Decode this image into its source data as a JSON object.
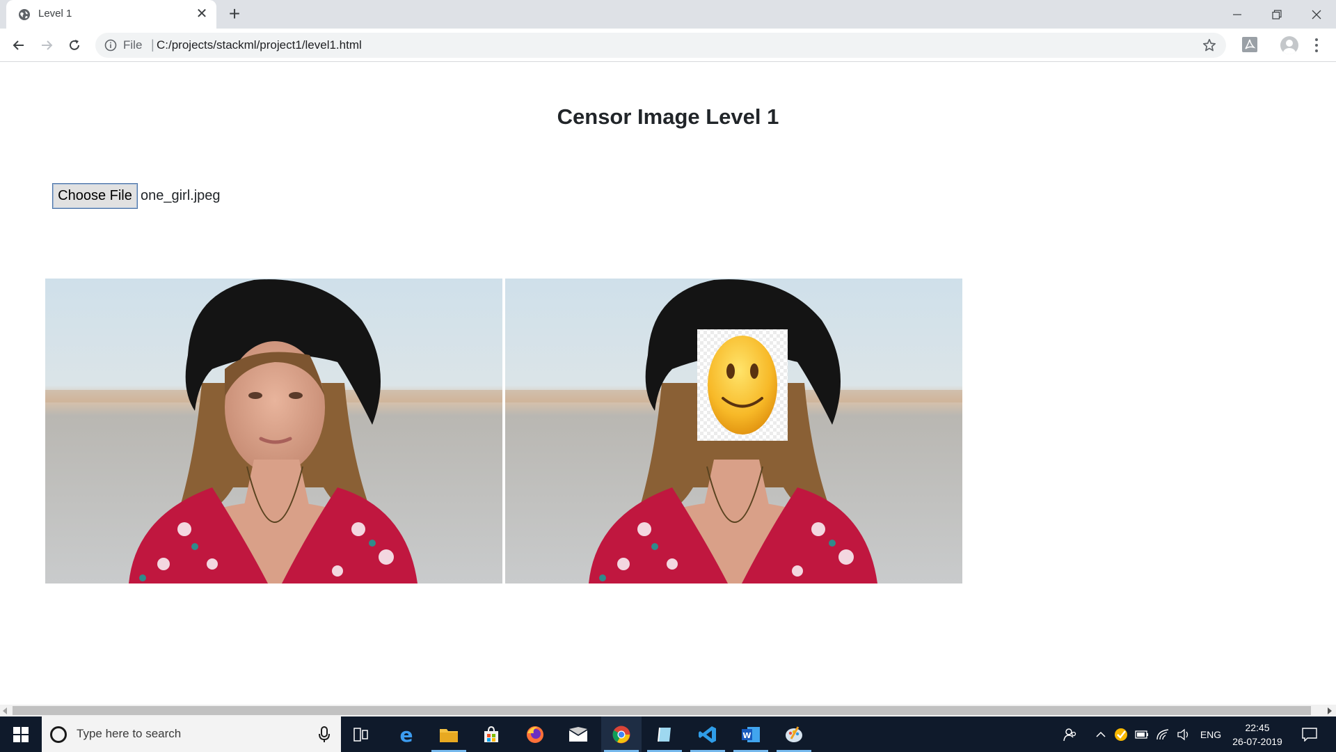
{
  "tab": {
    "title": "Level 1"
  },
  "omnibox": {
    "scheme": "File",
    "url": "C:/projects/stackml/project1/level1.html"
  },
  "page": {
    "title": "Censor Image Level 1",
    "choose_file_label": "Choose File",
    "file_name": "one_girl.jpeg"
  },
  "taskbar": {
    "search_placeholder": "Type here to search",
    "language": "ENG",
    "time": "22:45",
    "date": "26-07-2019"
  },
  "colors": {
    "tabstrip": "#dee1e6",
    "taskbar": "#0f1a2b",
    "taskbar_active_underline": "#76b9ed"
  }
}
